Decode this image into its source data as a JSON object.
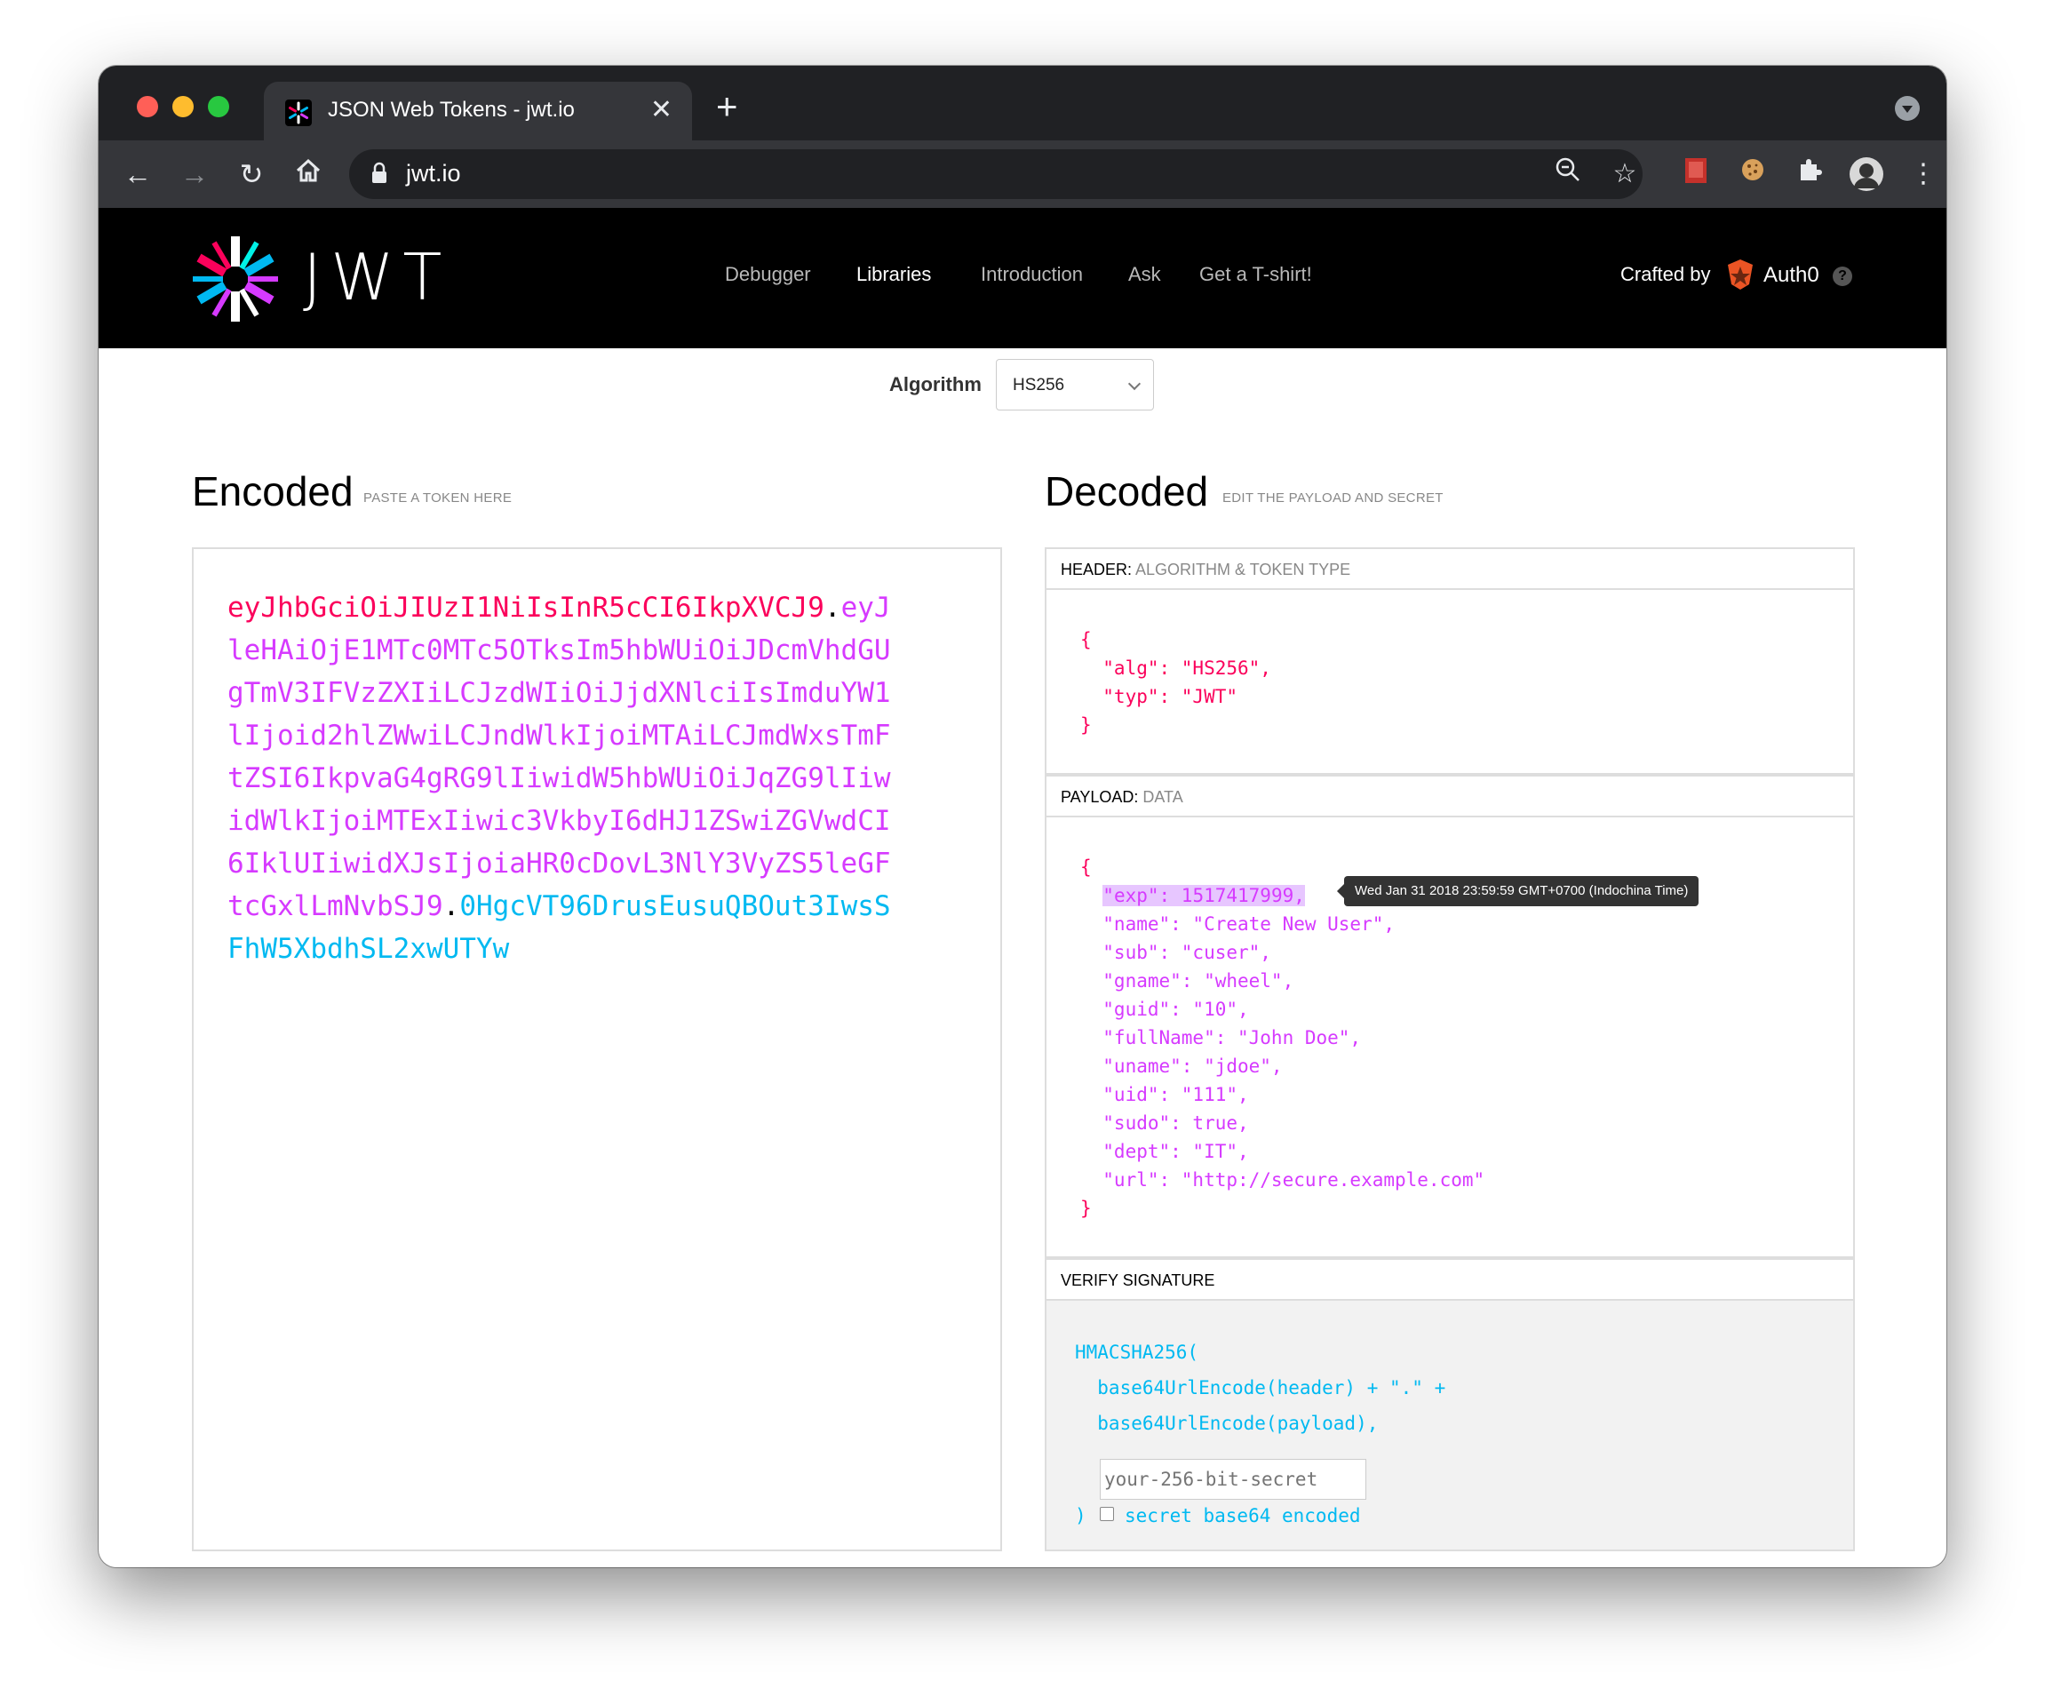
{
  "browser": {
    "tab_title": "JSON Web Tokens - jwt.io",
    "url": "jwt.io"
  },
  "site": {
    "wordmark": "JWT",
    "nav": [
      "Debugger",
      "Libraries",
      "Introduction",
      "Ask",
      "Get a T-shirt!"
    ],
    "active_nav": "Libraries",
    "crafted_by": "Crafted by",
    "auth0": "Auth0",
    "help": "?"
  },
  "algorithm": {
    "label": "Algorithm",
    "value": "HS256"
  },
  "encoded": {
    "title": "Encoded",
    "subtitle": "PASTE A TOKEN HERE",
    "header_part": "eyJhbGciOiJIUzI1NiIsInR5cCI6IkpXVCJ9",
    "payload_part": "eyJleHAiOjE1MTc0MTc5OTksIm5hbWUiOiJDcmVhdGUgTmV3IFVzZXIiLCJzdWIiOiJjdXNlciIsImduYW1lIjoid2hlZWwiLCJndWlkIjoiMTAiLCJmdWxsTmFtZSI6IkpvaG4gRG9lIiwidW5hbWUiOiJqZG9lIiwidWlkIjoiMTExIiwic3VkbyI6dHJ1ZSwiZGVwdCI6IklUIiwidXJsIjoiaHR0cDovL3NlY3VyZS5leGFtcGxlLmNvbSJ9",
    "signature_part": "0HgcVT96DrusEusuQBOut3IwsSFhW5XbdhSL2xwUTYw",
    "dot": "."
  },
  "decoded": {
    "title": "Decoded",
    "subtitle": "EDIT THE PAYLOAD AND SECRET",
    "header_label": "HEADER:",
    "header_desc": "ALGORITHM & TOKEN TYPE",
    "header_lines": [
      "{",
      "  \"alg\": \"HS256\",",
      "  \"typ\": \"JWT\"",
      "}"
    ],
    "payload_label": "PAYLOAD:",
    "payload_desc": "DATA",
    "payload_open": "{",
    "payload_exp": "\"exp\": 1517417999,",
    "payload_lines": [
      "  \"name\": \"Create New User\",",
      "  \"sub\": \"cuser\",",
      "  \"gname\": \"wheel\",",
      "  \"guid\": \"10\",",
      "  \"fullName\": \"John Doe\",",
      "  \"uname\": \"jdoe\",",
      "  \"uid\": \"111\",",
      "  \"sudo\": true,",
      "  \"dept\": \"IT\",",
      "  \"url\": \"http://secure.example.com\""
    ],
    "payload_close": "}",
    "exp_tooltip": "Wed Jan 31 2018 23:59:59 GMT+0700 (Indochina Time)",
    "verify_label": "VERIFY SIGNATURE",
    "verify_lines": [
      "HMACSHA256(",
      "  base64UrlEncode(header) + \".\" +",
      "  base64UrlEncode(payload),"
    ],
    "secret_placeholder": "your-256-bit-secret",
    "close_paren": ")",
    "base64_label": "secret base64 encoded"
  },
  "colors": {
    "header": "#fb015b",
    "payload": "#d63aff",
    "signature": "#00b9f1"
  }
}
